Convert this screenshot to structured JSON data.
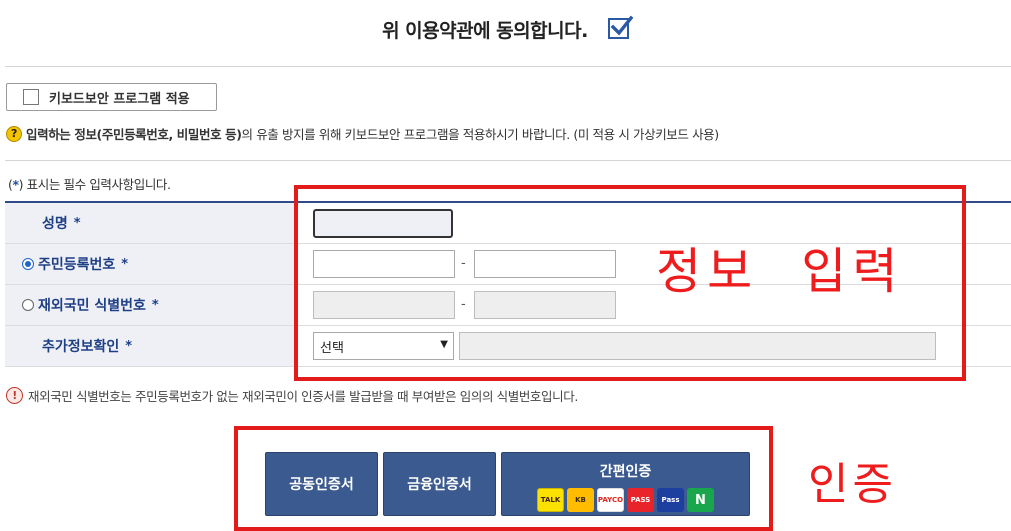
{
  "agreement": {
    "text": "위 이용약관에 동의합니다.",
    "checked": true
  },
  "keyboard_security": {
    "button_label": "키보드보안 프로그램 적용"
  },
  "help": {
    "bold_text": "입력하는 정보(주민등록번호, 비밀번호 등)",
    "rest_text": "의 유출 방지를 위해 키보드보안 프로그램을 적용하시기 바랍니다. (미 적용 시 가상키보드 사용)"
  },
  "required_note": {
    "prefix": "(",
    "star": "*",
    "suffix": ") 표시는 필수 입력사항입니다."
  },
  "form": {
    "rows": [
      {
        "label": "성명",
        "star": "*"
      },
      {
        "label": "주민등록번호",
        "star": "*",
        "selected": true
      },
      {
        "label": "재외국민 식별번호",
        "star": "*",
        "selected": false
      },
      {
        "label": "추가정보확인",
        "star": "*"
      }
    ],
    "dash": "-",
    "select_value": "선택",
    "select_arrow": "▼"
  },
  "annotation_info": "정보  입력",
  "annotation_cert": "인증",
  "warning": {
    "icon": "!",
    "text": "재외국민 식별번호는 주민등록번호가 없는 재외국민이 인증서를 발급받을 때 부여받은 임의의 식별번호입니다."
  },
  "certs": {
    "joint": "공동인증서",
    "financial": "금융인증서",
    "simple": "간편인증",
    "providers": [
      "TALK",
      "KB",
      "PAYCO",
      "PASS",
      "Pass",
      "N"
    ]
  },
  "colors": {
    "accent_blue": "#1f3f85",
    "button_blue": "#3b5a8f",
    "annotation_red": "#e41b1b"
  }
}
